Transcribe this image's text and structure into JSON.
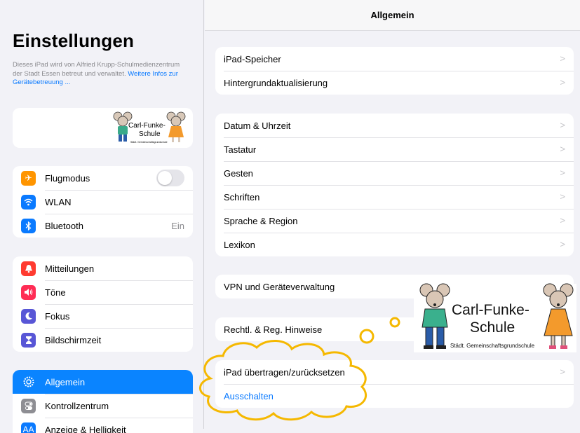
{
  "sidebar": {
    "title": "Einstellungen",
    "description": "Dieses iPad wird von Alfried Krupp-Schulmedienzentrum der Stadt Essen betreut und verwaltet.",
    "description_link": "Weitere Infos zur Gerätebetreuung ...",
    "logo_text_1": "Carl-Funke-",
    "logo_text_2": "Schule",
    "logo_sub": "Städt. Gemeinschaftsgrundschule",
    "group1": [
      {
        "label": "Flugmodus",
        "icon": "airplane-icon",
        "color": "#ff9500",
        "toggle": false
      },
      {
        "label": "WLAN",
        "icon": "wifi-icon",
        "color": "#0a7aff"
      },
      {
        "label": "Bluetooth",
        "icon": "bluetooth-icon",
        "color": "#0a7aff",
        "value": "Ein"
      }
    ],
    "group2": [
      {
        "label": "Mitteilungen",
        "icon": "bell-icon",
        "color": "#ff3b30"
      },
      {
        "label": "Töne",
        "icon": "speaker-icon",
        "color": "#ff2d55"
      },
      {
        "label": "Fokus",
        "icon": "moon-icon",
        "color": "#5856d6"
      },
      {
        "label": "Bildschirmzeit",
        "icon": "hourglass-icon",
        "color": "#5856d6"
      }
    ],
    "group3": [
      {
        "label": "Allgemein",
        "icon": "gear-icon",
        "color": "#8e8e93",
        "selected": true
      },
      {
        "label": "Kontrollzentrum",
        "icon": "switches-icon",
        "color": "#8e8e93"
      },
      {
        "label": "Anzeige & Helligkeit",
        "icon": "brightness-icon",
        "color": "#0a7aff"
      }
    ]
  },
  "main": {
    "title": "Allgemein",
    "group1": [
      "iPad-Speicher",
      "Hintergrundaktualisierung"
    ],
    "group2": [
      "Datum & Uhrzeit",
      "Tastatur",
      "Gesten",
      "Schriften",
      "Sprache & Region",
      "Lexikon"
    ],
    "group3": [
      "VPN und Geräteverwaltung"
    ],
    "group4": [
      "Rechtl. & Reg. Hinweise"
    ],
    "group5": [
      "iPad übertragen/zurücksetzen"
    ],
    "shutdown": "Ausschalten"
  },
  "overlay": {
    "logo_text_1": "Carl-Funke-",
    "logo_text_2": "Schule",
    "logo_sub": "Städt. Gemeinschaftsgrundschule"
  },
  "colors": {
    "accent": "#0a84ff",
    "highlight": "#f5b800"
  }
}
